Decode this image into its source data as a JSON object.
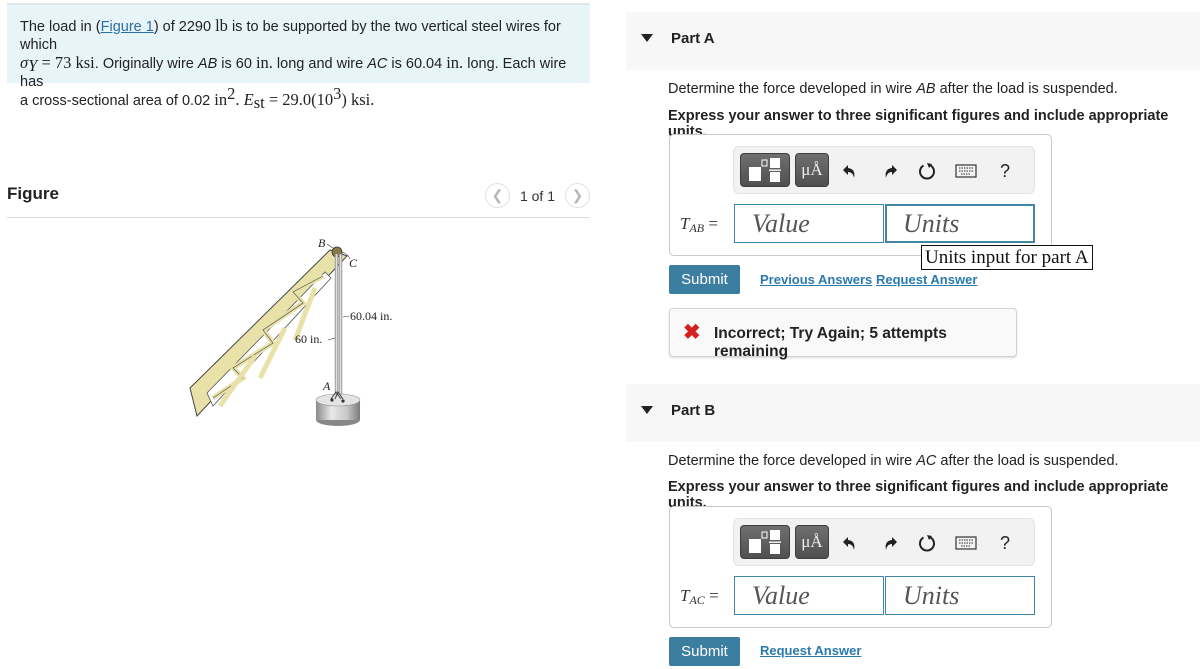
{
  "problem": {
    "intro": "The load in (",
    "figure_link": "Figure 1",
    "after_link": ") of 2290 ",
    "load_unit": "lb",
    "after_unit": " is to be supported by the two vertical steel wires for which",
    "sigma_label": "σ",
    "sigma_sub": "Y",
    "sigma_eq": " = 73 ksi",
    "line2_a": ". Originally wire ",
    "wire_ab": "AB",
    "line2_b": " is 60 ",
    "in_unit": "in.",
    "line2_c": " long and wire ",
    "wire_ac": "AC",
    "line2_d": " is 60.04 ",
    "line2_e": " long. Each wire has",
    "line3_a": "a cross-sectional area of 0.02 ",
    "area_unit": "in",
    "area_exp": "2",
    "line3_b": ". ",
    "e_label": "E",
    "e_sub": "st",
    "e_eq": " = 29.0(10",
    "e_exp": "3",
    "e_end": ") ksi."
  },
  "figure": {
    "title": "Figure",
    "counter": "1 of 1",
    "prev_icon": "chevron-left-icon",
    "next_icon": "chevron-right-icon",
    "labels": {
      "b": "B",
      "c": "C",
      "a": "A",
      "len_ac": "60.04 in.",
      "len_ab": "60 in."
    }
  },
  "parts": [
    {
      "title": "Part A",
      "question_a": "Determine the force developed in wire ",
      "wire": "AB",
      "question_b": " after the load is suspended.",
      "instruction": "Express your answer to three significant figures and include appropriate units.",
      "lhs_var": "T",
      "lhs_sub": "AB",
      "lhs_eq": " =",
      "value_placeholder": "Value",
      "units_placeholder": "Units",
      "tooltip": "Units input for part A",
      "submit": "Submit",
      "previous_answers": "Previous Answers",
      "request_answer": "Request Answer",
      "feedback": "Incorrect; Try Again; 5 attempts remaining"
    },
    {
      "title": "Part B",
      "question_a": "Determine the force developed in wire ",
      "wire": "AC",
      "question_b": " after the load is suspended.",
      "instruction": "Express your answer to three significant figures and include appropriate units.",
      "lhs_var": "T",
      "lhs_sub": "AC",
      "lhs_eq": " =",
      "value_placeholder": "Value",
      "units_placeholder": "Units",
      "submit": "Submit",
      "request_answer": "Request Answer"
    }
  ],
  "toolbar": {
    "units_label": "μÅ",
    "help_label": "?",
    "icons": [
      "templates-icon",
      "units-icon",
      "undo-icon",
      "redo-icon",
      "reset-icon",
      "keyboard-icon",
      "help-icon"
    ]
  },
  "colors": {
    "accent": "#3c7ea0",
    "link": "#2a7ab0",
    "error": "#d42020",
    "problem_bg": "#e8f5f8"
  }
}
